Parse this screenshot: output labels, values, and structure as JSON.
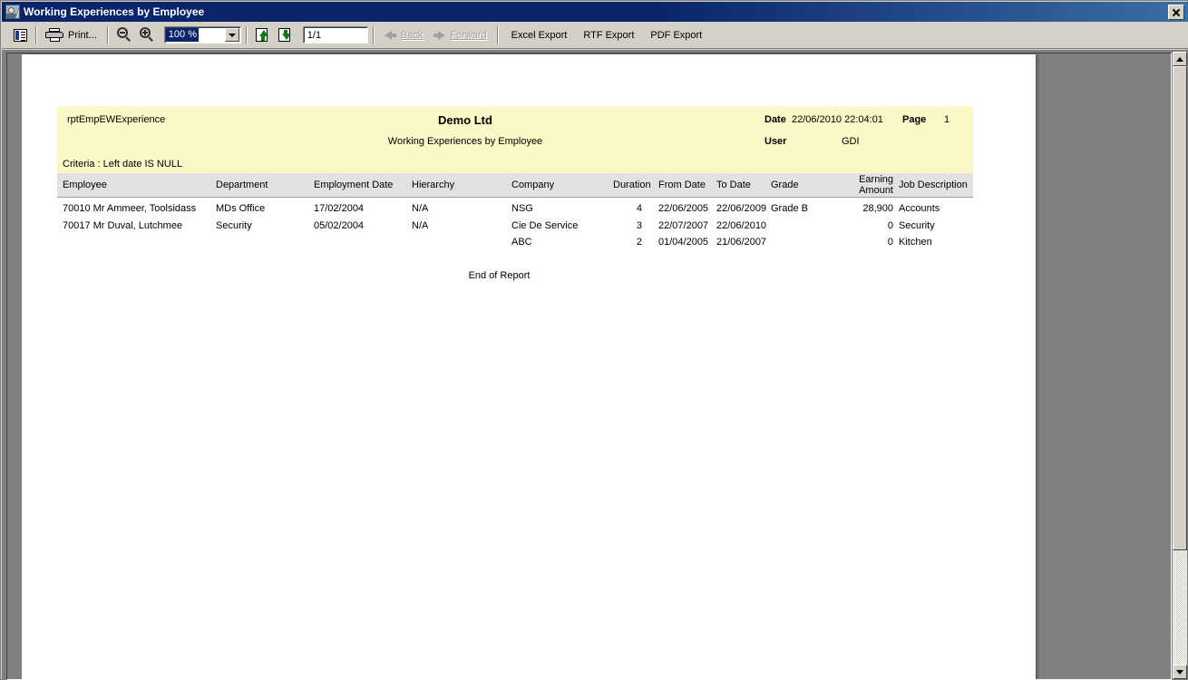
{
  "window": {
    "title": "Working Experiences by Employee",
    "icon": "report-designer-icon",
    "close_label": "close-icon"
  },
  "toolbar": {
    "report_view_icon": "report-view-icon",
    "print_icon": "printer-icon",
    "print_label": "Print...",
    "zoom_out_icon": "zoom-out-icon",
    "zoom_in_icon": "zoom-in-icon",
    "zoom_value": "100 %",
    "zoom_options": [
      "100 %"
    ],
    "prev_page_icon": "page-up-icon",
    "next_page_icon": "page-down-icon",
    "page_value": "1/1",
    "back_icon": "arrow-left-icon",
    "back_label": "Back",
    "forward_icon": "arrow-right-icon",
    "forward_label": "Forward",
    "excel_export_label": "Excel Export",
    "rtf_export_label": "RTF Export",
    "pdf_export_label": "PDF Export"
  },
  "report": {
    "report_id": "rptEmpEWExperience",
    "company": "Demo Ltd",
    "subtitle": "Working Experiences by Employee",
    "criteria": "Criteria : Left date IS NULL",
    "date_label": "Date",
    "date_value": "22/06/2010 22:04:01",
    "page_label": "Page",
    "page_value": "1",
    "user_label": "User",
    "user_value": "GDI",
    "columns": [
      "Employee",
      "Department",
      "Employment Date",
      "Hierarchy",
      "Company",
      "Duration",
      "From Date",
      "To Date",
      "Grade",
      "Earning Amount",
      "Job Description"
    ],
    "earning_amount_line1": "Earning",
    "earning_amount_line2": "Amount",
    "rows": [
      {
        "employee": "70010 Mr Ammeer, Toolsidass",
        "department": "MDs Office",
        "employment_date": "17/02/2004",
        "hierarchy": "N/A",
        "company": "NSG",
        "duration": "4",
        "from_date": "22/06/2005",
        "to_date": "22/06/2009",
        "grade": "Grade B",
        "earning_amount": "28,900",
        "job_description": "Accounts"
      },
      {
        "employee": "70017 Mr Duval, Lutchmee",
        "department": "Security",
        "employment_date": "05/02/2004",
        "hierarchy": "N/A",
        "company": "Cie De Service",
        "duration": "3",
        "from_date": "22/07/2007",
        "to_date": "22/06/2010",
        "grade": "",
        "earning_amount": "0",
        "job_description": "Security"
      },
      {
        "employee": "",
        "department": "",
        "employment_date": "",
        "hierarchy": "",
        "company": "ABC",
        "duration": "2",
        "from_date": "01/04/2005",
        "to_date": "21/06/2007",
        "grade": "",
        "earning_amount": "0",
        "job_description": "Kitchen"
      }
    ],
    "footer": "End of Report"
  },
  "colors": {
    "titlebar": "#0a246a",
    "header_band": "#fbf8c8",
    "column_header": "#e3e1e3",
    "window_chrome": "#d4d0c8",
    "page_background": "#808080"
  }
}
